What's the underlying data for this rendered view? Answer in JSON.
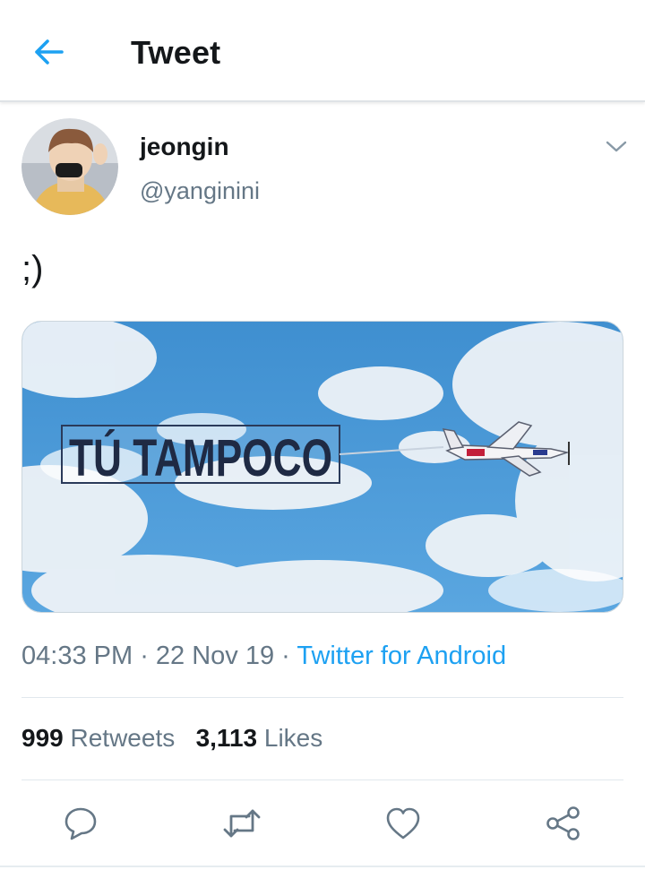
{
  "header": {
    "back_icon": "arrow-left-icon",
    "title": "Tweet"
  },
  "tweet": {
    "author": {
      "display_name": "jeongin",
      "handle": "@yanginini",
      "avatar_icon": "profile-photo"
    },
    "text": ";)",
    "media": {
      "banner_text": "TÚ TAMPOCO"
    },
    "meta": {
      "time": "04:33 PM",
      "separator": " · ",
      "date": "22 Nov 19",
      "source": "Twitter for Android"
    },
    "stats": {
      "retweets_count": "999",
      "retweets_label": "Retweets",
      "likes_count": "3,113",
      "likes_label": "Likes"
    }
  },
  "actions": {
    "reply_icon": "reply-icon",
    "retweet_icon": "retweet-icon",
    "like_icon": "heart-icon",
    "share_icon": "share-icon"
  },
  "colors": {
    "accent": "#1da1f2",
    "text_primary": "#14171a",
    "text_secondary": "#657786",
    "divider": "#e1e8ed"
  }
}
